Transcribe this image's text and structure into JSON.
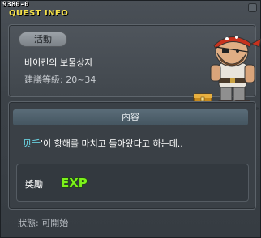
{
  "window": {
    "quest_id": "9380-0",
    "title": "QUEST INFO"
  },
  "quest": {
    "badge": "活動",
    "name": "바이킨의 보물상자",
    "level": "建議等級: 20~34"
  },
  "content": {
    "header": "內容",
    "description_highlight": "贝千",
    "description_rest": "'이 항해를 마치고 돌아왔다고 하는데.."
  },
  "reward": {
    "label": "獎勵",
    "icon": "exp-icon",
    "icon_text": "EXP"
  },
  "status": {
    "text": "狀態:  可開始"
  },
  "colors": {
    "title": "#f4e04a",
    "highlight": "#6ee0f0",
    "exp": "#7cf21a"
  }
}
